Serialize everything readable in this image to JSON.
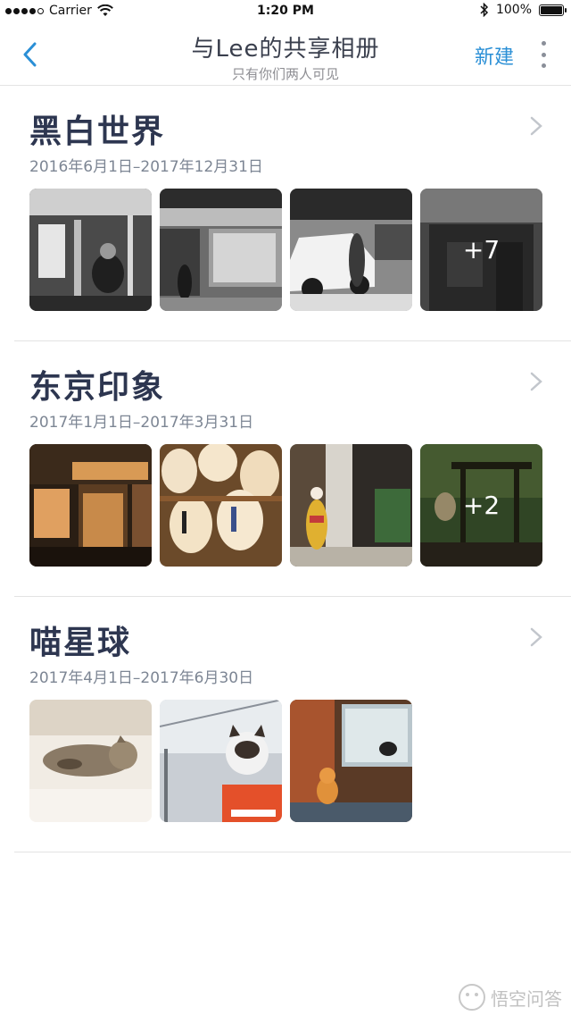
{
  "status_bar": {
    "carrier": "Carrier",
    "time": "1:20 PM",
    "battery": "100%"
  },
  "nav": {
    "title": "与Lee的共享相册",
    "subtitle": "只有你们两人可见",
    "new_label": "新建"
  },
  "albums": [
    {
      "title": "黑白世界",
      "dates": "2016年6月1日–2017年12月31日",
      "more_count": "+7"
    },
    {
      "title": "东京印象",
      "dates": "2017年1月1日–2017年3月31日",
      "more_count": "+2"
    },
    {
      "title": "喵星球",
      "dates": "2017年4月1日–2017年6月30日",
      "more_count": ""
    }
  ],
  "watermark": "悟空问答",
  "colors": {
    "accent": "#2a8fd6",
    "title": "#2d3650",
    "subtext": "#7d8694"
  }
}
